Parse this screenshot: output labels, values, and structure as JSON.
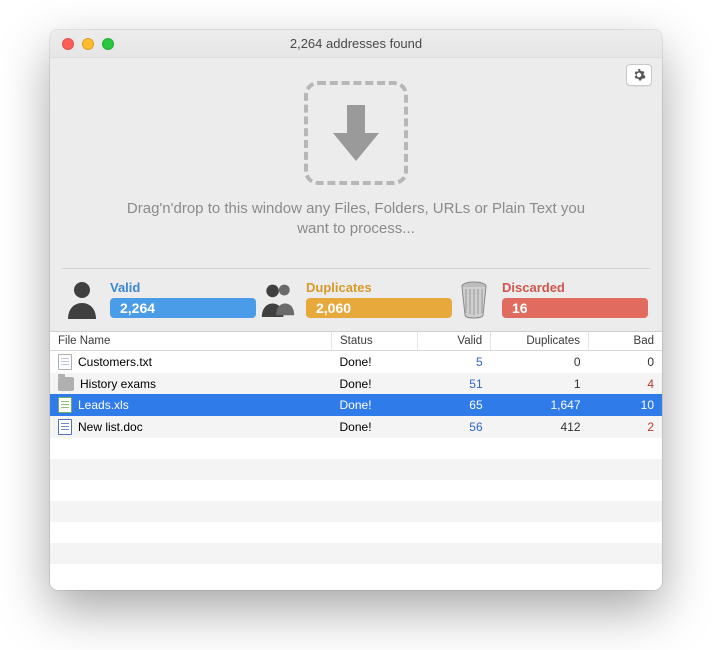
{
  "window": {
    "title": "2,264 addresses found"
  },
  "dropzone": {
    "instructions": "Drag'n'drop to this window any Files, Folders, URLs or Plain Text you want to process..."
  },
  "stats": {
    "valid": {
      "label": "Valid",
      "count": "2,264"
    },
    "duplicates": {
      "label": "Duplicates",
      "count": "2,060"
    },
    "discarded": {
      "label": "Discarded",
      "count": "16"
    }
  },
  "table": {
    "columns": [
      "File Name",
      "Status",
      "Valid",
      "Duplicates",
      "Bad"
    ],
    "rows": [
      {
        "icon": "txt",
        "name": "Customers.txt",
        "status": "Done!",
        "valid": "5",
        "duplicates": "0",
        "bad": "0",
        "selected": false
      },
      {
        "icon": "folder",
        "name": "History exams",
        "status": "Done!",
        "valid": "51",
        "duplicates": "1",
        "bad": "4",
        "selected": false
      },
      {
        "icon": "xls",
        "name": "Leads.xls",
        "status": "Done!",
        "valid": "65",
        "duplicates": "1,647",
        "bad": "10",
        "selected": true
      },
      {
        "icon": "doc",
        "name": "New list.doc",
        "status": "Done!",
        "valid": "56",
        "duplicates": "412",
        "bad": "2",
        "selected": false
      }
    ],
    "empty_rows": 6
  },
  "colors": {
    "valid": "#4a9be8",
    "duplicates": "#e7a93c",
    "discarded": "#e06b5e",
    "selection": "#2f7bea",
    "link_blue": "#2f66c4",
    "bad_red": "#c03a2b"
  }
}
